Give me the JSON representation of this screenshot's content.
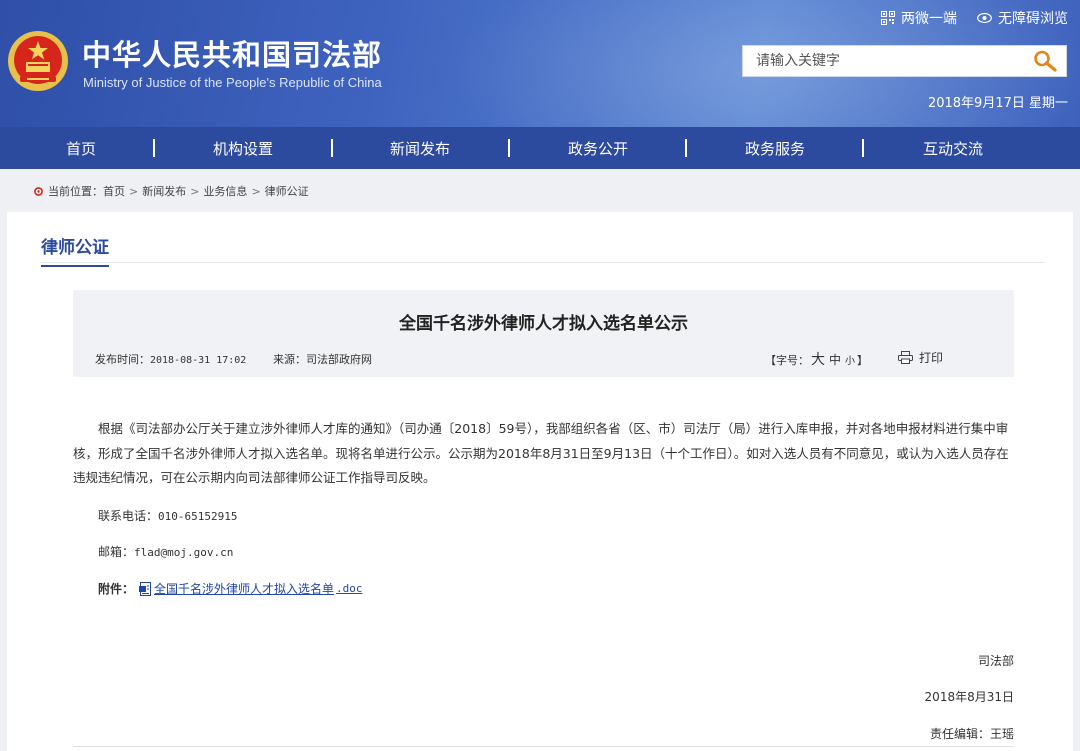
{
  "header": {
    "title": "中华人民共和国司法部",
    "subtitle": "Ministry of Justice of the People's Republic of China",
    "top_links": [
      {
        "label": "两微一端",
        "icon": "qrcode-icon"
      },
      {
        "label": "无障碍浏览",
        "icon": "eye-icon"
      }
    ],
    "search": {
      "placeholder": "请输入关键字",
      "icon": "search-icon"
    },
    "date": "2018年9月17日 星期一"
  },
  "nav": {
    "items": [
      "首页",
      "机构设置",
      "新闻发布",
      "政务公开",
      "政务服务",
      "互动交流"
    ]
  },
  "breadcrumb": {
    "label": "当前位置：",
    "items": [
      "首页",
      "新闻发布",
      "业务信息",
      "律师公证"
    ],
    "separator": ">"
  },
  "section": {
    "title": "律师公证"
  },
  "article": {
    "title": "全国千名涉外律师人才拟入选名单公示",
    "publish_label": "发布时间：",
    "publish_time": "2018-08-31 17:02",
    "source_label": "来源：",
    "source": "司法部政府网",
    "font_size_label": "【字号：",
    "font_sizes": [
      "大",
      "中",
      "小"
    ],
    "font_size_close": "】",
    "print_label": "打印",
    "body": "根据《司法部办公厅关于建立涉外律师人才库的通知》（司办通〔2018〕59号），我部组织各省（区、市）司法厅（局）进行入库申报，并对各地申报材料进行集中审核，形成了全国千名涉外律师人才拟入选名单。现将名单进行公示。公示期为2018年8月31日至9月13日（十个工作日）。如对入选人员有不同意见，或认为入选人员存在违规违纪情况，可在公示期内向司法部律师公证工作指导司反映。",
    "phone_label": "联系电话：",
    "phone": "010-65152915",
    "email_label": "邮箱：",
    "email": "flad@moj.gov.cn",
    "attach_label": "附件：",
    "attach_name": "全国千名涉外律师人才拟入选名单",
    "attach_ext": ".doc",
    "signer": "司法部",
    "sign_date": "2018年8月31日",
    "editor_label": "责任编辑：",
    "editor": "王瑶"
  },
  "colors": {
    "header_blue": "#3e63bf",
    "nav_blue": "#2c4a9e",
    "emblem_red": "#d6261c",
    "emblem_gold": "#e8c14a",
    "search_icon": "#e0861c"
  }
}
